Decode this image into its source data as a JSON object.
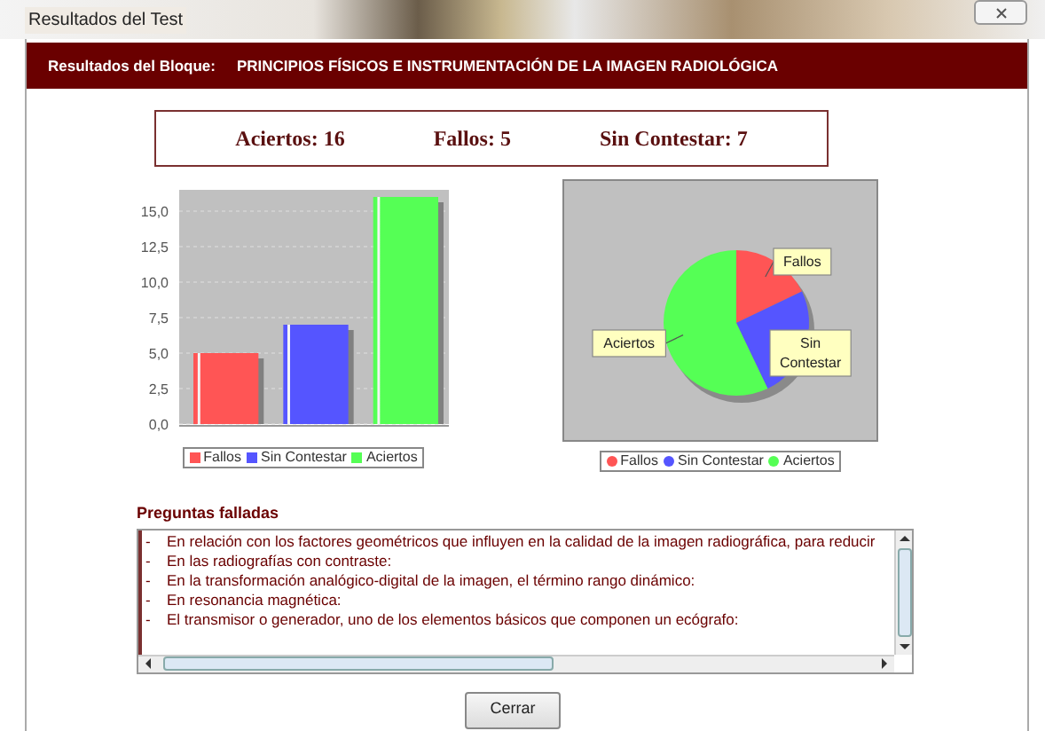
{
  "window": {
    "title": "Resultados del Test"
  },
  "header": {
    "label": "Resultados del Bloque:",
    "block": "PRINCIPIOS FÍSICOS E INSTRUMENTACIÓN DE LA IMAGEN RADIOLÓGICA"
  },
  "scores": [
    {
      "label": "Aciertos:",
      "value": "16"
    },
    {
      "label": "Fallos:",
      "value": "5"
    },
    {
      "label": "Sin Contestar:",
      "value": "7"
    }
  ],
  "bar_chart": {
    "chart_data": {
      "type": "bar",
      "categories": [
        null
      ],
      "grid": true,
      "series": [
        {
          "name": "Fallos",
          "color": "#ff5555",
          "values": [
            5
          ]
        },
        {
          "name": "Sin Contestar",
          "color": "#5555ff",
          "values": [
            7
          ]
        },
        {
          "name": "Aciertos",
          "color": "#55ff55",
          "values": [
            16
          ]
        }
      ],
      "ylim": [
        0,
        16.5
      ],
      "yticks": [
        {
          "value": 0,
          "label": "0,0"
        },
        {
          "value": 2.5,
          "label": "2,5"
        },
        {
          "value": 5,
          "label": "5,0"
        },
        {
          "value": 7.5,
          "label": "7,5"
        },
        {
          "value": 10,
          "label": "10,0"
        },
        {
          "value": 12.5,
          "label": "12,5"
        },
        {
          "value": 15,
          "label": "15,0"
        }
      ]
    }
  },
  "pie_chart": {
    "chart_data": {
      "type": "pie",
      "categories": [
        "Fallos",
        "Sin Contestar",
        "Aciertos"
      ],
      "series": [
        {
          "values": [
            17.9,
            25,
            57.1
          ]
        }
      ],
      "colors": [
        "#ff5555",
        "#5555ff",
        "#55ff55"
      ]
    }
  },
  "failed": {
    "title": "Preguntas falladas",
    "rows": [
      {
        "marker": "-",
        "text": "En relación con los factores geométricos que influyen en la calidad de la imagen radiográfica, para reducir"
      },
      {
        "marker": "-",
        "text": "En las radiografías con contraste:"
      },
      {
        "marker": "-",
        "text": "En la transformación analógico-digital de la imagen, el término rango dinámico:"
      },
      {
        "marker": "-",
        "text": "En resonancia magnética:"
      },
      {
        "marker": "-",
        "text": "El transmisor o generador, uno de los elementos básicos que componen un ecógrafo:"
      }
    ]
  },
  "buttons": [
    "Cerrar"
  ]
}
